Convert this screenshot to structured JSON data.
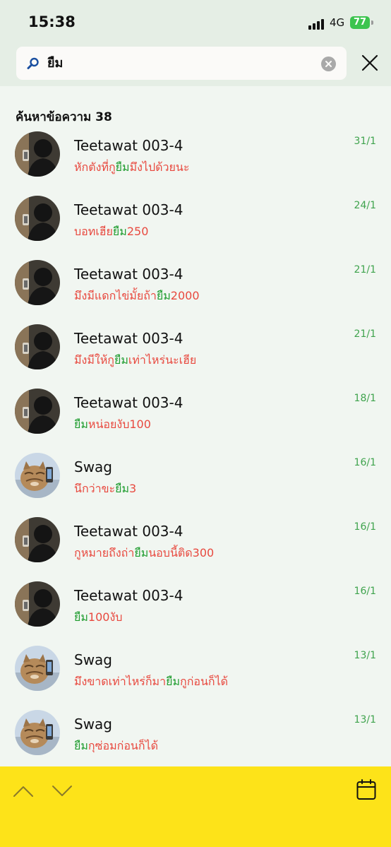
{
  "status_bar": {
    "time": "15:38",
    "network": "4G",
    "battery": "77"
  },
  "search": {
    "value": "ยืม",
    "icon": "search-icon",
    "clear_icon": "clear-icon",
    "close_icon": "close-icon"
  },
  "results": {
    "heading": "ค้นหาข้อความ 38",
    "items": [
      {
        "name": "Teetawat 003-4",
        "date": "31/1",
        "avatar": "teetawat",
        "snippet": [
          {
            "t": "หักตังที่กู",
            "hl": false
          },
          {
            "t": "ยืม",
            "hl": true
          },
          {
            "t": "มึงไปด้วยนะ",
            "hl": false
          }
        ]
      },
      {
        "name": "Teetawat 003-4",
        "date": "24/1",
        "avatar": "teetawat",
        "snippet": [
          {
            "t": "บอทเฮีย",
            "hl": false
          },
          {
            "t": "ยืม",
            "hl": true
          },
          {
            "t": "250",
            "hl": false
          }
        ]
      },
      {
        "name": "Teetawat 003-4",
        "date": "21/1",
        "avatar": "teetawat",
        "snippet": [
          {
            "t": "มึงมีแดกไข่มั้ยถ้า",
            "hl": false
          },
          {
            "t": "ยืม",
            "hl": true
          },
          {
            "t": "2000",
            "hl": false
          }
        ]
      },
      {
        "name": "Teetawat 003-4",
        "date": "21/1",
        "avatar": "teetawat",
        "snippet": [
          {
            "t": "มึงมีให้กู",
            "hl": false
          },
          {
            "t": "ยืม",
            "hl": true
          },
          {
            "t": "เท่าไหร่นะเฮีย",
            "hl": false
          }
        ]
      },
      {
        "name": "Teetawat 003-4",
        "date": "18/1",
        "avatar": "teetawat",
        "snippet": [
          {
            "t": "ยืม",
            "hl": true
          },
          {
            "t": "หน่อยงับ100",
            "hl": false
          }
        ]
      },
      {
        "name": "Swag",
        "date": "16/1",
        "avatar": "swag",
        "snippet": [
          {
            "t": "นึกว่าขะ",
            "hl": false
          },
          {
            "t": "ยืม",
            "hl": true
          },
          {
            "t": "3",
            "hl": false
          }
        ]
      },
      {
        "name": "Teetawat 003-4",
        "date": "16/1",
        "avatar": "teetawat",
        "snippet": [
          {
            "t": "กูหมายถึงถ่า",
            "hl": false
          },
          {
            "t": "ยืม",
            "hl": true
          },
          {
            "t": "นอบนี้ติด300",
            "hl": false
          }
        ]
      },
      {
        "name": "Teetawat 003-4",
        "date": "16/1",
        "avatar": "teetawat",
        "snippet": [
          {
            "t": "ยืม",
            "hl": true
          },
          {
            "t": "100งับ",
            "hl": false
          }
        ]
      },
      {
        "name": "Swag",
        "date": "13/1",
        "avatar": "swag",
        "snippet": [
          {
            "t": "มึงขาดเท่าไหร่ก็มา",
            "hl": false
          },
          {
            "t": "ยืม",
            "hl": true
          },
          {
            "t": "กูก่อนก็ได้",
            "hl": false
          }
        ]
      },
      {
        "name": "Swag",
        "date": "13/1",
        "avatar": "swag",
        "snippet": [
          {
            "t": "ยืม",
            "hl": true
          },
          {
            "t": "กุซ่อมก่อนก็ได้",
            "hl": false
          }
        ]
      }
    ]
  },
  "bottom_bar": {
    "up_icon": "chevron-up-icon",
    "down_icon": "chevron-down-icon",
    "calendar_icon": "calendar-icon"
  },
  "colors": {
    "highlight": "#1f9c2f",
    "snippet": "#e8493f",
    "date": "#3fa34d",
    "bottom_bar": "#fde319",
    "header": "#e5eee5",
    "background": "#f1f6f1"
  }
}
